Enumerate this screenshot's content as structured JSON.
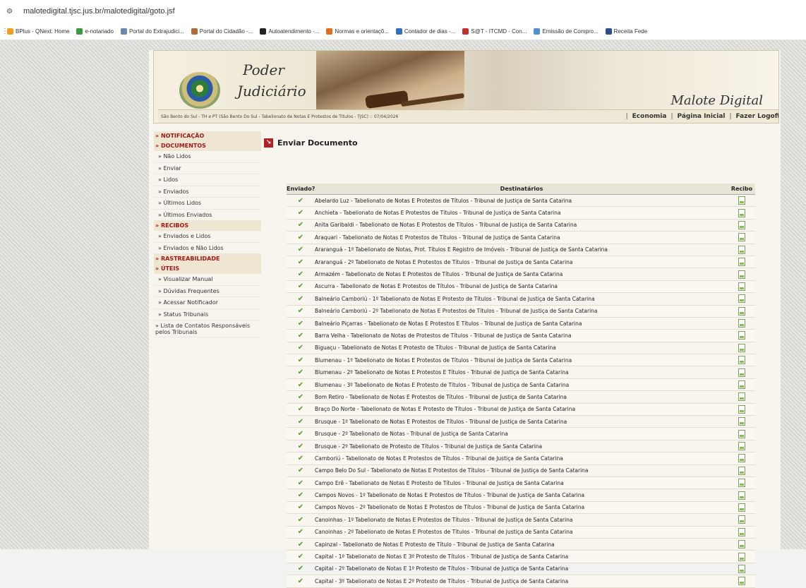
{
  "browser": {
    "url": "malotedigital.tjsc.jus.br/malotedigital/goto.jsf",
    "bookmarks": [
      {
        "label": "BPlus - QNext: Home",
        "color": "#f0a020"
      },
      {
        "label": "e-notariado",
        "color": "#3b9a3b"
      },
      {
        "label": "Portal do Extrajudici...",
        "color": "#6b86b0"
      },
      {
        "label": "Portal do Cidadão -...",
        "color": "#b06b3b"
      },
      {
        "label": "Autoatendimento -...",
        "color": "#222222"
      },
      {
        "label": "Normas e orientaçõ...",
        "color": "#e07020"
      },
      {
        "label": "Contador de dias -...",
        "color": "#3070c0"
      },
      {
        "label": "S@T - ITCMD - Con...",
        "color": "#c03030"
      },
      {
        "label": "Emissão de Compro...",
        "color": "#5090d0"
      },
      {
        "label": "Receita Fede",
        "color": "#2a4f8a"
      }
    ]
  },
  "header": {
    "poder": "Poder",
    "judiciario": "Judiciário",
    "app_title": "Malote Digital",
    "info": "São Bento do Sul - TH e PT (São Bento Do Sul - Tabelionato de Notas E Protestos de Títulos - TJSC) :: 07/04/2026",
    "links": {
      "economia": "Economia",
      "pagina_inicial": "Página Inicial",
      "logoff": "Fazer Logoff"
    }
  },
  "sidebar": {
    "notificacao": "» NOTIFICAÇÃO",
    "documentos": "» DOCUMENTOS",
    "doc_items": [
      "» Não Lidos",
      "» Enviar",
      "» Lidos",
      "» Enviados",
      "» Últimos Lidos",
      "» Últimos Enviados"
    ],
    "recibos": "» RECIBOS",
    "recibo_items": [
      "» Enviados e Lidos",
      "» Enviados e Não Lidos"
    ],
    "rastreabilidade": "» RASTREABILIDADE",
    "uteis": "» ÚTEIS",
    "uteis_items": [
      "» Visualizar Manual",
      "» Dúvidas Frequentes",
      "» Acessar Notificador",
      "» Status Tribunais",
      "» Lista de Contatos Responsáveis pelos Tribunais"
    ]
  },
  "main": {
    "title": "Enviar Documento",
    "columns": {
      "sent": "Enviado?",
      "dest": "Destinatários",
      "receipt": "Recibo"
    },
    "rows": [
      "Abelardo Luz - Tabelionato de Notas E Protestos de Títulos - Tribunal de Justiça de Santa Catarina",
      "Anchieta - Tabelionato de Notas E Protestos de Títulos - Tribunal de Justiça de Santa Catarina",
      "Anita Garibaldi - Tabelionato de Notas E Protestos de Títulos - Tribunal de Justiça de Santa Catarina",
      "Araquari - Tabelionato de Notas E Protestos de Títulos - Tribunal de Justiça de Santa Catarina",
      "Araranguá - 1º Tabelionato de Notas, Prot. Títulos E Registro de Imóveis - Tribunal de Justiça de Santa Catarina",
      "Araranguá - 2º Tabelionato de Notas E Protestos de Títulos - Tribunal de Justiça de Santa Catarina",
      "Armazém - Tabelionato de Notas E Protestos de Títulos - Tribunal de Justiça de Santa Catarina",
      "Ascurra - Tabelionato de Notas E Protestos de Títulos - Tribunal de Justiça de Santa Catarina",
      "Balneário Camboriú - 1º Tabelionato de Notas E Protesto de Títulos - Tribunal de Justiça de Santa Catarina",
      "Balneário Camboriú - 2º Tabelionato de Notas E Protestos de Títulos - Tribunal de Justiça de Santa Catarina",
      "Balneário Piçarras - Tabelionato de Notas E Protestos E Títulos - Tribunal de Justiça de Santa Catarina",
      "Barra Velha - Tabelionato de Notas de Protestos de Títulos - Tribunal de Justiça de Santa Catarina",
      "Biguaçu - Tabelionato de Notas E Protesto de Títulos - Tribunal de Justiça de Santa Catarina",
      "Blumenau - 1º Tabelionato de Notas E Protestos de Títulos - Tribunal de Justiça de Santa Catarina",
      "Blumenau - 2º Tabelionato de Notas E Protestos E Títulos - Tribunal de Justiça de Santa Catarina",
      "Blumenau - 3º Tabelionato de Notas E Protesto de Títulos - Tribunal de Justiça de Santa Catarina",
      "Bom Retiro - Tabelionato de Notas E Protestos de Títulos - Tribunal de Justiça de Santa Catarina",
      "Braço Do Norte - Tabelionato de Notas E Protesto de Títulos - Tribunal de Justiça de Santa Catarina",
      "Brusque - 1º Tabelionato de Notas E Protestos de Títulos - Tribunal de Justiça de Santa Catarina",
      "Brusque - 2º Tabelionato de Notas - Tribunal de Justiça de Santa Catarina",
      "Brusque - 2º Tabelionato de Protesto de Títulos - Tribunal de Justiça de Santa Catarina",
      "Camboriú - Tabelionato de Notas E Protestos de Títulos - Tribunal de Justiça de Santa Catarina",
      "Campo Belo Do Sul - Tabelionato de Notas E Protestos de Títulos - Tribunal de Justiça de Santa Catarina",
      "Campo Erê - Tabelionato de Notas E Protesto de Títulos - Tribunal de Justiça de Santa Catarina",
      "Campos Novos - 1º Tabelionato de Notas E Protestos de Títulos - Tribunal de Justiça de Santa Catarina",
      "Campos Novos - 2º Tabelionato de Notas E Protestos de Títulos - Tribunal de Justiça de Santa Catarina",
      "Canoinhas - 1º Tabelionato de Notas E Protestos de Títulos - Tribunal de Justiça de Santa Catarina",
      "Canoinhas - 2º Tabelionato de Notas E Protestos de Títulos - Tribunal de Justiça de Santa Catarina",
      "Capinzal - Tabelionato de Notas E Protesto de Título - Tribunal de Justiça de Santa Catarina",
      "Capital - 1º Tabelionato de Notas E 3º Protesto de Títulos - Tribunal de Justiça de Santa Catarina",
      "Capital - 2º Tabelionato de Notas E 1º Protesto de Títulos - Tribunal de Justiça de Santa Catarina",
      "Capital - 3º Tabelionato de Notas E 2º Protesto de Títulos - Tribunal de Justiça de Santa Catarina"
    ]
  }
}
